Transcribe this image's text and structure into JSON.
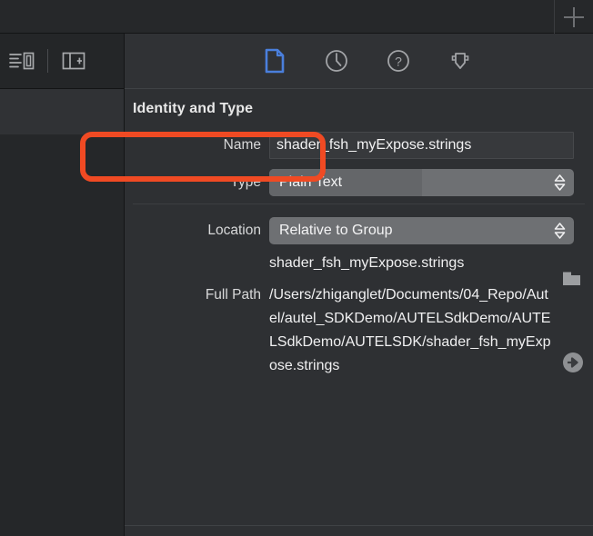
{
  "titlebar": {
    "add_button_label": "+",
    "add_icon": "plus-icon"
  },
  "left_toolbar": {
    "items": [
      {
        "icon": "navigator-list-icon",
        "label": "Show Navigator"
      },
      {
        "icon": "add-editor-icon",
        "label": "Add Editor"
      }
    ]
  },
  "inspector": {
    "tabs": [
      {
        "icon": "file-inspector-icon",
        "label": "File Inspector",
        "selected": true
      },
      {
        "icon": "history-clock-icon",
        "label": "History Inspector",
        "selected": false
      },
      {
        "icon": "quick-help-icon",
        "label": "Quick Help Inspector",
        "selected": false
      },
      {
        "icon": "insert-arrow-icon",
        "label": "Library",
        "selected": false
      }
    ],
    "section_title": "Identity and Type",
    "fields": {
      "name": {
        "label": "Name",
        "value": "shader_fsh_myExpose.strings",
        "placeholder": "Name"
      },
      "type": {
        "label": "Type",
        "value": "Plain Text"
      },
      "location": {
        "label": "Location",
        "value": "Relative to Group"
      },
      "filename": {
        "label": "",
        "value": "shader_fsh_myExpose.strings",
        "folder_icon": "folder-icon"
      },
      "full_path": {
        "label": "Full Path",
        "value": "/Users/zhiganglet/Documents/04_Repo/Autel/autel_SDKDemo/AUTELSdkDemo/AUTELSdkDemo/AUTELSDK/shader_fsh_myExpose.strings",
        "reveal_icon": "arrow-right-circle-icon"
      }
    }
  },
  "annotation": {
    "highlight_color": "#f04a23",
    "target": "type-row"
  },
  "colors": {
    "accent_blue": "#4a7fdc",
    "panel_bg": "#2e3033",
    "sidebar_bg": "#252729",
    "popup_bg": "#6e7073",
    "highlight": "#f04a23"
  }
}
